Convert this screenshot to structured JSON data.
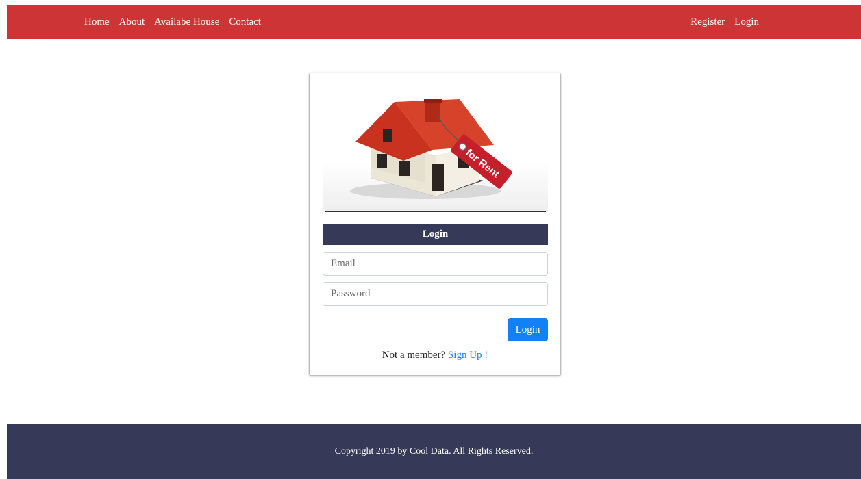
{
  "nav": {
    "left": [
      "Home",
      "About",
      "Availabe House",
      "Contact"
    ],
    "right": [
      "Register",
      "Login"
    ]
  },
  "hero": {
    "tag_text": "for Rent"
  },
  "form": {
    "title": "Login",
    "email_placeholder": "Email",
    "password_placeholder": "Password",
    "submit_label": "Login",
    "signup_prompt": "Not a member?",
    "signup_link": "Sign Up !"
  },
  "footer": {
    "copyright": "Copyright 2019 by Cool Data. All Rights Reserved."
  },
  "colors": {
    "nav_bg": "#cc3436",
    "dark_navy": "#363a58",
    "primary_blue": "#1181f5"
  }
}
